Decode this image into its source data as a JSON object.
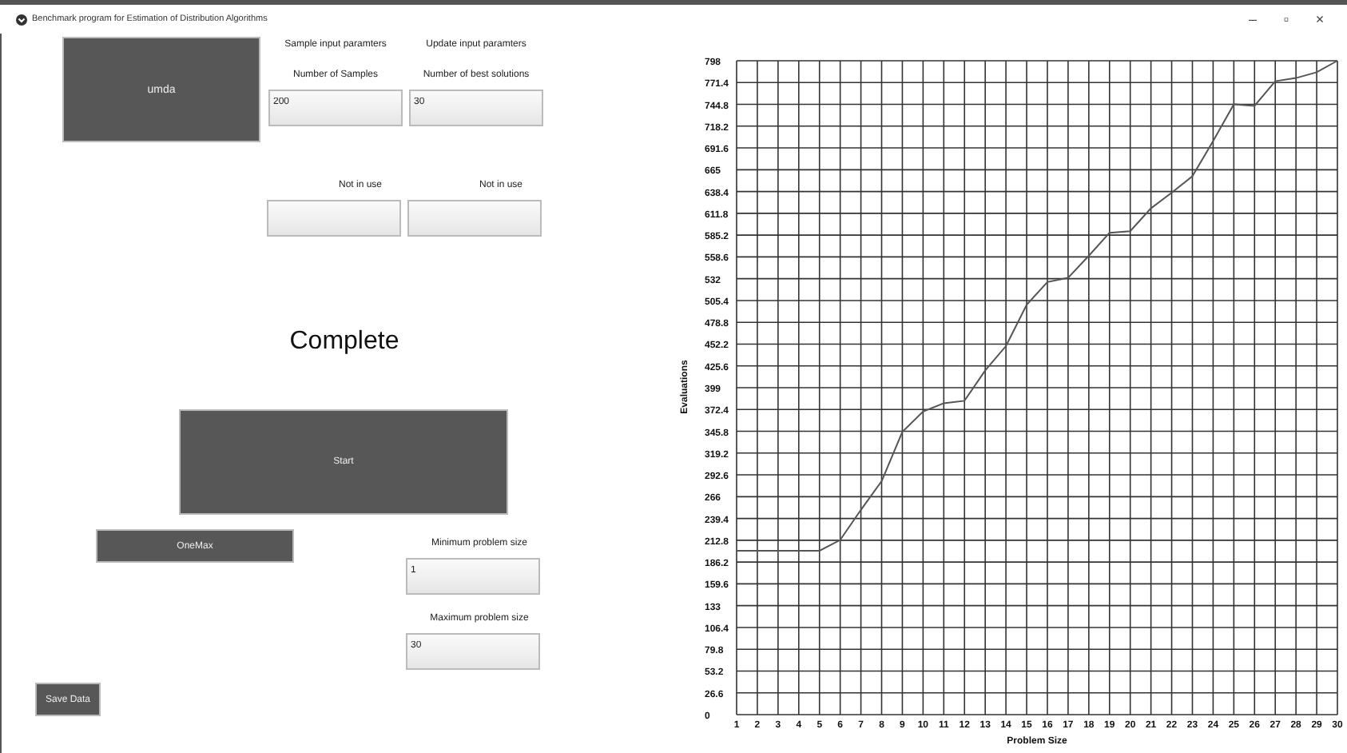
{
  "window": {
    "title": "Benchmark program for Estimation of Distribution Algorithms",
    "controls": [
      "–",
      "▫",
      "×"
    ]
  },
  "algorithm_button": "umda",
  "section_labels": [
    "Sample input paramters",
    "Update input paramters"
  ],
  "parameter_fields": [
    {
      "label": "Number of Samples",
      "value": "200"
    },
    {
      "label": "Number of best solutions",
      "value": "30"
    },
    {
      "label": "Not in use"
    },
    {
      "label": "Not in use"
    }
  ],
  "status": "Complete",
  "start_button": "Start",
  "problem_button": "OneMax",
  "size_fields": [
    {
      "label": "Minimum problem size",
      "value": "1"
    },
    {
      "label": "Maximum problem size",
      "value": "30"
    }
  ],
  "save_button": "Save Data",
  "chart_data": {
    "type": "line",
    "xlabel": "Problem Size",
    "ylabel": "Evaluations",
    "x": [
      1,
      2,
      3,
      4,
      5,
      6,
      7,
      8,
      9,
      10,
      11,
      12,
      13,
      14,
      15,
      16,
      17,
      18,
      19,
      20,
      21,
      22,
      23,
      24,
      25,
      26,
      27,
      28,
      29,
      30
    ],
    "grid": true,
    "series": [
      {
        "color": "#555555",
        "values": [
          200,
          200,
          200,
          200,
          200,
          213,
          250,
          285,
          345,
          370,
          380,
          383,
          420,
          450,
          500,
          528,
          533,
          560,
          588,
          590,
          618,
          637,
          657,
          700,
          745,
          743,
          773,
          777,
          784,
          798
        ]
      }
    ],
    "xlim": [
      1,
      30
    ],
    "ylim": [
      0,
      798
    ],
    "xticks": [
      1,
      2,
      3,
      4,
      5,
      6,
      7,
      8,
      9,
      10,
      11,
      12,
      13,
      14,
      15,
      16,
      17,
      18,
      19,
      20,
      21,
      22,
      23,
      24,
      25,
      26,
      27,
      28,
      29,
      30
    ],
    "yticks": [
      0,
      26.6,
      53.2,
      79.8,
      106.4,
      133,
      159.6,
      186.2,
      212.8,
      239.4,
      266,
      292.6,
      319.2,
      345.8,
      372.4,
      399,
      425.6,
      452.2,
      478.8,
      505.4,
      532,
      558.6,
      585.2,
      611.8,
      638.4,
      665,
      691.6,
      718.2,
      744.8,
      771.4,
      798
    ]
  }
}
